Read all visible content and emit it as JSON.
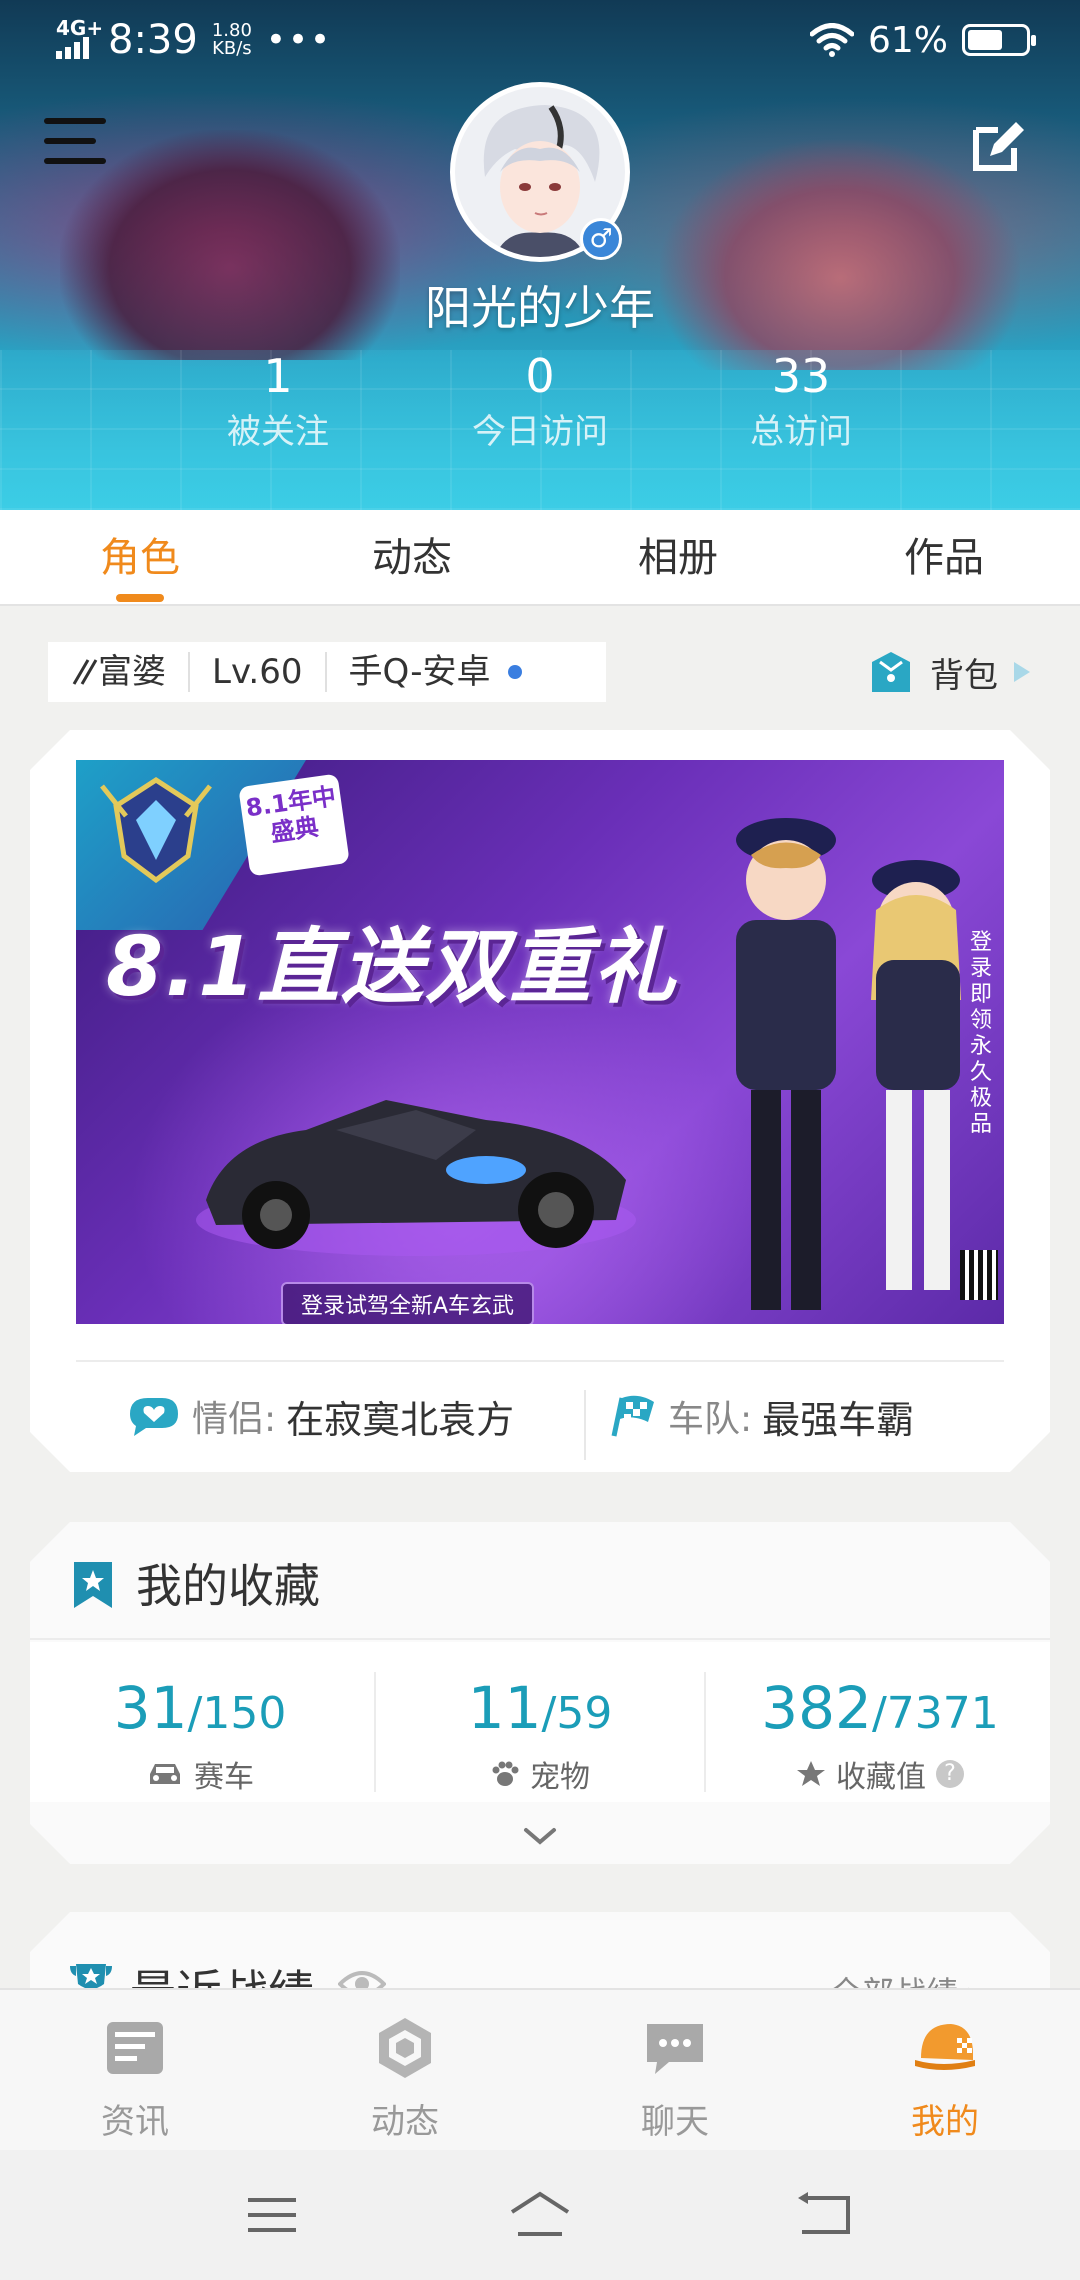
{
  "status_bar": {
    "network": "4G+",
    "time": "8:39",
    "speed_value": "1.80",
    "speed_unit": "KB/s",
    "dots": "•••",
    "battery_text": "61%",
    "battery_level": 0.61
  },
  "profile": {
    "username": "阳光的少年",
    "gender_symbol": "♂",
    "stats": [
      {
        "value": "1",
        "label": "被关注"
      },
      {
        "value": "0",
        "label": "今日访问"
      },
      {
        "value": "33",
        "label": "总访问"
      }
    ]
  },
  "tabs": [
    {
      "label": "角色",
      "active": true
    },
    {
      "label": "动态",
      "active": false
    },
    {
      "label": "相册",
      "active": false
    },
    {
      "label": "作品",
      "active": false
    }
  ],
  "role_info": {
    "title_tag": "富婆",
    "level": "Lv.60",
    "platform": "手Q-安卓",
    "bag_label": "背包"
  },
  "banner": {
    "badge": "8.1年中盛典",
    "title": "8.1直送双重礼",
    "caption": "登录试驾全新A车玄武",
    "side_text": "登录即领永久极品"
  },
  "role_card": {
    "partner_label": "情侣:",
    "partner_value": "在寂寞北袁方",
    "team_label": "车队:",
    "team_value": "最强车霸"
  },
  "collection": {
    "title": "我的收藏",
    "items": [
      {
        "current": "31",
        "total": "/150",
        "label": "赛车",
        "icon": "car-icon"
      },
      {
        "current": "11",
        "total": "/59",
        "label": "宠物",
        "icon": "paw-icon"
      },
      {
        "current": "382",
        "total": "/7371",
        "label": "收藏值",
        "icon": "star-icon"
      }
    ],
    "help_symbol": "?"
  },
  "records": {
    "title": "最近战绩",
    "all_label": "全部战绩 ▸"
  },
  "bottom_nav": [
    {
      "label": "资讯",
      "icon": "news-icon",
      "active": false
    },
    {
      "label": "动态",
      "icon": "feed-icon",
      "active": false
    },
    {
      "label": "聊天",
      "icon": "chat-icon",
      "active": false
    },
    {
      "label": "我的",
      "icon": "cap-icon",
      "active": true
    }
  ],
  "colors": {
    "accent": "#f08a1c",
    "teal": "#1b9db8",
    "header_bg": "#2aa3c4"
  }
}
